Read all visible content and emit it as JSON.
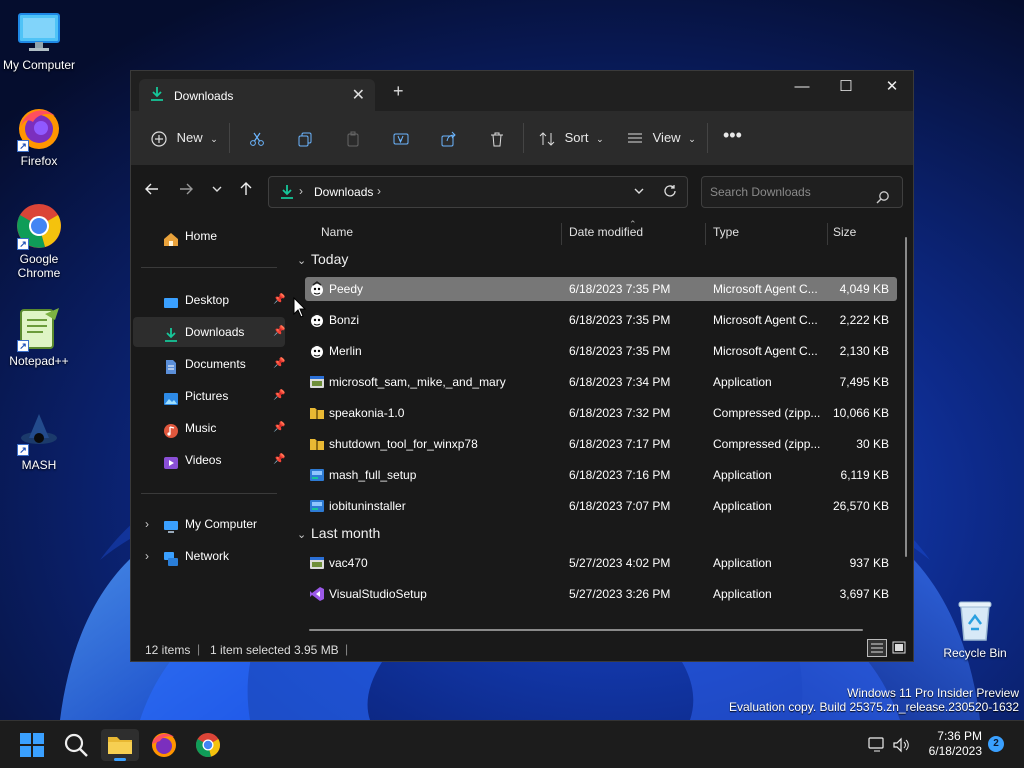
{
  "desktop": {
    "icons": [
      {
        "label": "My Computer"
      },
      {
        "label": "Firefox"
      },
      {
        "label": "Google Chrome"
      },
      {
        "label": "Notepad++"
      },
      {
        "label": "MASH"
      },
      {
        "label": "Recycle Bin"
      }
    ],
    "watermark_line1": "Windows 11 Pro Insider Preview",
    "watermark_line2": "Evaluation copy. Build 25375.zn_release.230520-1632"
  },
  "window": {
    "tab_title": "Downloads",
    "toolbar": {
      "new_label": "New",
      "sort_label": "Sort",
      "view_label": "View"
    },
    "address": {
      "location": "Downloads",
      "search_placeholder": "Search Downloads"
    },
    "sidebar": {
      "home": "Home",
      "pinned": [
        "Desktop",
        "Downloads",
        "Documents",
        "Pictures",
        "Music",
        "Videos"
      ],
      "selected": "Downloads",
      "tree": [
        "My Computer",
        "Network"
      ]
    },
    "columns": {
      "name": "Name",
      "date": "Date modified",
      "type": "Type",
      "size": "Size"
    },
    "groups": [
      {
        "label": "Today",
        "files": [
          {
            "name": "Peedy",
            "date": "6/18/2023 7:35 PM",
            "type": "Microsoft Agent C...",
            "size": "4,049 KB",
            "icon": "agent-character-icon",
            "selected": true
          },
          {
            "name": "Bonzi",
            "date": "6/18/2023 7:35 PM",
            "type": "Microsoft Agent C...",
            "size": "2,222 KB",
            "icon": "agent-character-icon"
          },
          {
            "name": "Merlin",
            "date": "6/18/2023 7:35 PM",
            "type": "Microsoft Agent C...",
            "size": "2,130 KB",
            "icon": "agent-character-icon"
          },
          {
            "name": "microsoft_sam,_mike,_and_mary",
            "date": "6/18/2023 7:34 PM",
            "type": "Application",
            "size": "7,495 KB",
            "icon": "application-icon"
          },
          {
            "name": "speakonia-1.0",
            "date": "6/18/2023 7:32 PM",
            "type": "Compressed (zipp...",
            "size": "10,066 KB",
            "icon": "zip-folder-icon"
          },
          {
            "name": "shutdown_tool_for_winxp78",
            "date": "6/18/2023 7:17 PM",
            "type": "Compressed (zipp...",
            "size": "30 KB",
            "icon": "zip-folder-icon"
          },
          {
            "name": "mash_full_setup",
            "date": "6/18/2023 7:16 PM",
            "type": "Application",
            "size": "6,119 KB",
            "icon": "installer-icon"
          },
          {
            "name": "iobituninstaller",
            "date": "6/18/2023 7:07 PM",
            "type": "Application",
            "size": "26,570 KB",
            "icon": "installer-icon"
          }
        ]
      },
      {
        "label": "Last month",
        "files": [
          {
            "name": "vac470",
            "date": "5/27/2023 4:02 PM",
            "type": "Application",
            "size": "937 KB",
            "icon": "application-icon"
          },
          {
            "name": "VisualStudioSetup",
            "date": "5/27/2023 3:26 PM",
            "type": "Application",
            "size": "3,697 KB",
            "icon": "visual-studio-icon"
          }
        ]
      }
    ],
    "status": {
      "items": "12 items",
      "selected": "1 item selected",
      "size": "3.95 MB"
    }
  },
  "taskbar": {
    "time": "7:36 PM",
    "date": "6/18/2023",
    "notifications": "2"
  },
  "colors": {
    "accent_green": "#16c79a",
    "folder_yellow": "#e8b833",
    "selection": "#777777",
    "window_bg": "#191919"
  }
}
